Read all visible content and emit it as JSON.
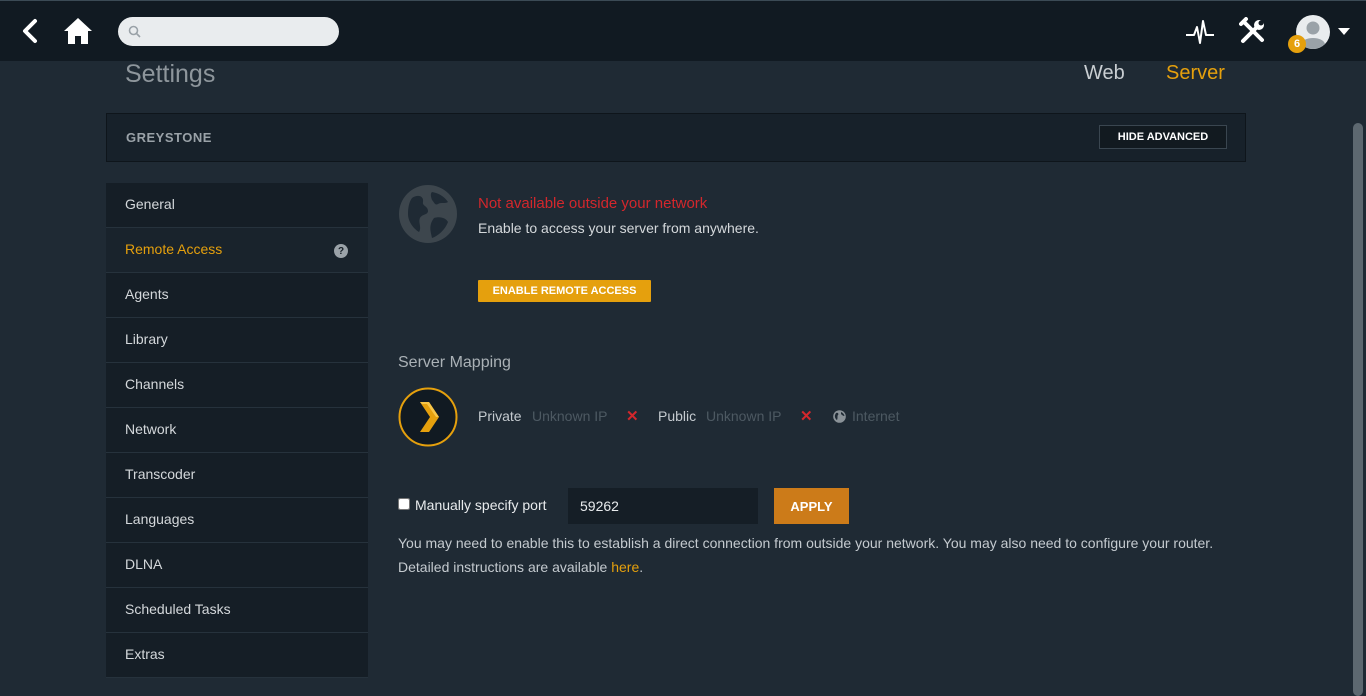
{
  "topbar": {
    "search_placeholder": "",
    "notification_count": "6",
    "icons": [
      "back-arrow-icon",
      "home-icon",
      "search-icon",
      "activity-icon",
      "tools-icon",
      "avatar-icon",
      "caret-down-icon"
    ]
  },
  "header": {
    "title": "Settings",
    "tabs": {
      "web": "Web",
      "server": "Server"
    }
  },
  "server_bar": {
    "name": "GREYSTONE",
    "hide_advanced": "HIDE ADVANCED"
  },
  "sidebar": {
    "items": [
      {
        "label": "General"
      },
      {
        "label": "Remote Access",
        "active": true
      },
      {
        "label": "Agents"
      },
      {
        "label": "Library"
      },
      {
        "label": "Channels"
      },
      {
        "label": "Network"
      },
      {
        "label": "Transcoder"
      },
      {
        "label": "Languages"
      },
      {
        "label": "DLNA"
      },
      {
        "label": "Scheduled Tasks"
      },
      {
        "label": "Extras"
      }
    ],
    "help_glyph": "?"
  },
  "remote": {
    "status_title": "Not available outside your network",
    "status_sub": "Enable to access your server from anywhere.",
    "enable_button": "ENABLE REMOTE ACCESS"
  },
  "mapping": {
    "title": "Server Mapping",
    "private_label": "Private",
    "private_value": "Unknown IP",
    "public_label": "Public",
    "public_value": "Unknown IP",
    "internet_label": "Internet",
    "x_mark": "✕"
  },
  "port": {
    "checkbox_label": "Manually specify port",
    "checked": false,
    "value": "59262",
    "apply_button": "APPLY"
  },
  "help": {
    "text": "You may need to enable this to establish a direct connection from outside your network. You may also need to configure your router. Detailed instructions are available ",
    "link": "here",
    "suffix": "."
  },
  "colors": {
    "accent": "#e5a00d",
    "error": "#d3272c",
    "background": "#1f2a34",
    "topbar": "#111a22",
    "sidebar": "#151e26"
  }
}
